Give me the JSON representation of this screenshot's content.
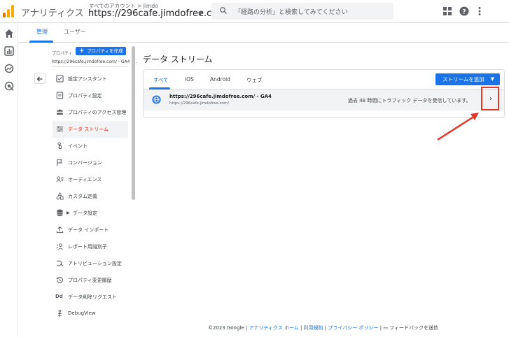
{
  "header": {
    "app_title": "アナリティクス",
    "account_breadcrumb": "すべてのアカウント > Jimdo",
    "property_name": "https://296cafe.jimdofree.c...",
    "search_placeholder": "「経路の分析」と検索してみてください"
  },
  "admin_tabs": {
    "admin": "管理",
    "user": "ユーザー"
  },
  "sidebar": {
    "property_label": "プロパティ",
    "create_property": "プロパティを作成",
    "property_name": "https://296cafe.jimdofree.com/ - GA4 (...",
    "items": [
      {
        "label": "設定アシスタント",
        "icon": "checklist-icon"
      },
      {
        "label": "プロパティ設定",
        "icon": "property-settings-icon"
      },
      {
        "label": "プロパティのアクセス管理",
        "icon": "people-icon"
      },
      {
        "label": "データ ストリーム",
        "icon": "data-stream-icon",
        "active": true
      },
      {
        "label": "イベント",
        "icon": "touch-icon"
      },
      {
        "label": "コンバージョン",
        "icon": "flag-icon"
      },
      {
        "label": "オーディエンス",
        "icon": "audience-icon"
      },
      {
        "label": "カスタム定義",
        "icon": "shapes-icon"
      },
      {
        "label": "データ設定",
        "icon": "database-icon",
        "expandable": true
      },
      {
        "label": "データ インポート",
        "icon": "upload-icon"
      },
      {
        "label": "レポート用識別子",
        "icon": "identity-icon"
      },
      {
        "label": "アトリビューション設定",
        "icon": "attribution-icon"
      },
      {
        "label": "プロパティ変更履歴",
        "icon": "history-icon"
      },
      {
        "label": "データ削除リクエスト",
        "icon": "dd-icon"
      },
      {
        "label": "DebugView",
        "icon": "debug-icon"
      }
    ]
  },
  "main": {
    "title": "データ ストリーム",
    "tabs": [
      "すべて",
      "iOS",
      "Android",
      "ウェブ"
    ],
    "active_tab": "すべて",
    "add_stream_button": "ストリームを追加",
    "stream": {
      "name": "https://296cafe.jimdofree.com/ - GA4",
      "url": "https://296cafe.jimdofree.com/",
      "status": "過去 48 時間にトラフィック データを受信しています。"
    }
  },
  "footer": {
    "copyright": "©2023 Google |",
    "home": "アナリティクス ホーム",
    "sep1": "|",
    "terms": "利用規約",
    "sep2": "|",
    "privacy": "プライバシー ポリシー",
    "sep3": "|",
    "feedback": "フィードバックを送信"
  },
  "colors": {
    "accent": "#1a73e8",
    "annotation": "#e0382b",
    "active_text": "#d93025"
  }
}
